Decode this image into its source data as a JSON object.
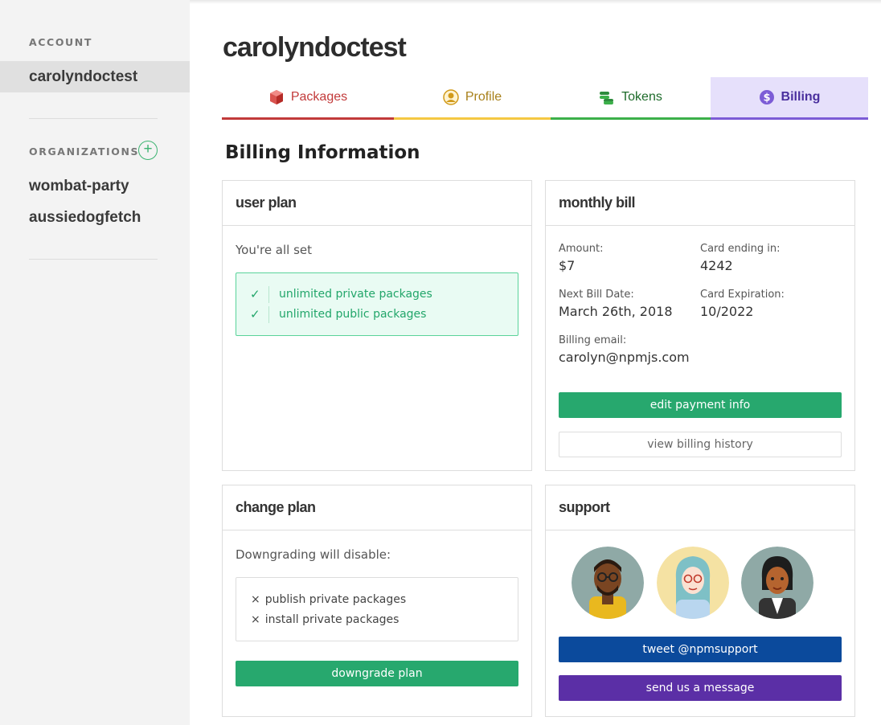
{
  "sidebar": {
    "account_heading": "ACCOUNT",
    "account_name": "carolyndoctest",
    "organizations_heading": "ORGANIZATIONS",
    "add_org_symbol": "+",
    "orgs": [
      "wombat-party",
      "aussiedogfetch"
    ]
  },
  "header": {
    "username": "carolyndoctest"
  },
  "tabs": [
    {
      "label": "Packages",
      "icon": "cube-icon",
      "color": "#c23a3a"
    },
    {
      "label": "Profile",
      "icon": "user-icon",
      "color": "#f5c842"
    },
    {
      "label": "Tokens",
      "icon": "coins-icon",
      "color": "#3cb04a"
    },
    {
      "label": "Billing",
      "icon": "dollar-icon",
      "color": "#7c5cd6",
      "active": true
    }
  ],
  "section_title": "Billing Information",
  "user_plan": {
    "title": "user plan",
    "status": "You're all set",
    "features": [
      "unlimited private packages",
      "unlimited public packages"
    ]
  },
  "monthly_bill": {
    "title": "monthly bill",
    "amount_label": "Amount:",
    "amount": "$7",
    "card_label": "Card ending in:",
    "card": "4242",
    "next_date_label": "Next Bill Date:",
    "next_date": "March 26th, 2018",
    "expiration_label": "Card Expiration:",
    "expiration": "10/2022",
    "email_label": "Billing email:",
    "email": "carolyn@npmjs.com",
    "edit_button": "edit payment info",
    "history_button": "view billing history"
  },
  "change_plan": {
    "title": "change plan",
    "intro": "Downgrading will disable:",
    "items": [
      "publish private packages",
      "install private packages"
    ],
    "x_symbol": "×",
    "downgrade_button": "downgrade plan"
  },
  "support": {
    "title": "support",
    "tweet_button": "tweet @npmsupport",
    "message_button": "send us a message"
  },
  "colors": {
    "accent_green": "#27a86e",
    "twitter_blue": "#0b4a9c",
    "purple": "#5b2fa6"
  }
}
